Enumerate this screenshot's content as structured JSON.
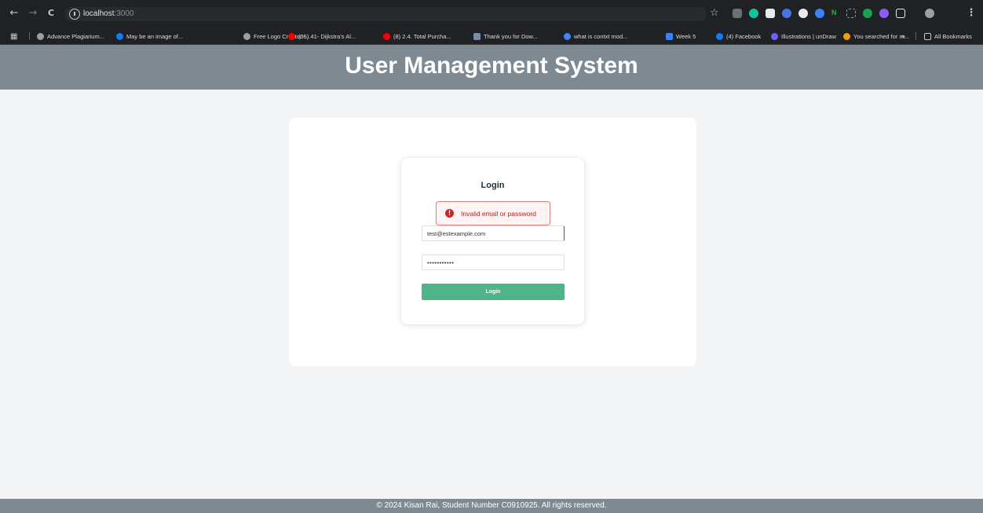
{
  "browser": {
    "back": "←",
    "forward": "→",
    "reload": "C",
    "url_host": "localhost",
    "url_port": ":3000",
    "star": "☆",
    "bookmarks": [
      {
        "label": "Advance Plagiarium...",
        "icon": "globe-icon",
        "color": "#9aa0a6"
      },
      {
        "label": "May be an image of...",
        "icon": "facebook-icon",
        "color": "#1877f2"
      },
      {
        "label": "Free Logo Creator -...",
        "icon": "globe-icon",
        "color": "#9aa0a6"
      },
      {
        "label": "(35) 41- Dijkstra's Al...",
        "icon": "youtube-icon",
        "color": "#ff0000"
      },
      {
        "label": "(8) 2.4. Total Purcha...",
        "icon": "youtube-icon",
        "color": "#ff0000"
      },
      {
        "label": "Thank you for Dow...",
        "icon": "xbox-icon",
        "color": "#7a8da5"
      },
      {
        "label": "what is contxt mod...",
        "icon": "google-icon",
        "color": "#4285f4"
      },
      {
        "label": "Week 5",
        "icon": "calendar-icon",
        "color": "#3b82f6"
      },
      {
        "label": "(4) Facebook",
        "icon": "facebook-icon",
        "color": "#1877f2"
      },
      {
        "label": "Illustrations | unDraw",
        "icon": "undraw-icon",
        "color": "#6c63ff"
      },
      {
        "label": "You searched for m...",
        "icon": "download-icon",
        "color": "#f59e0b"
      }
    ],
    "overflow": "»",
    "all_bookmarks": "All Bookmarks"
  },
  "header": {
    "title": "User Management System"
  },
  "login": {
    "heading": "Login",
    "error": "Invalid email or password",
    "email_value": "test@estexample.com",
    "password_value": "•••••••••••",
    "button_label": "Login"
  },
  "footer": {
    "text": "© 2024 Kisan Rai, Student Number C0910925. All rights reserved."
  }
}
